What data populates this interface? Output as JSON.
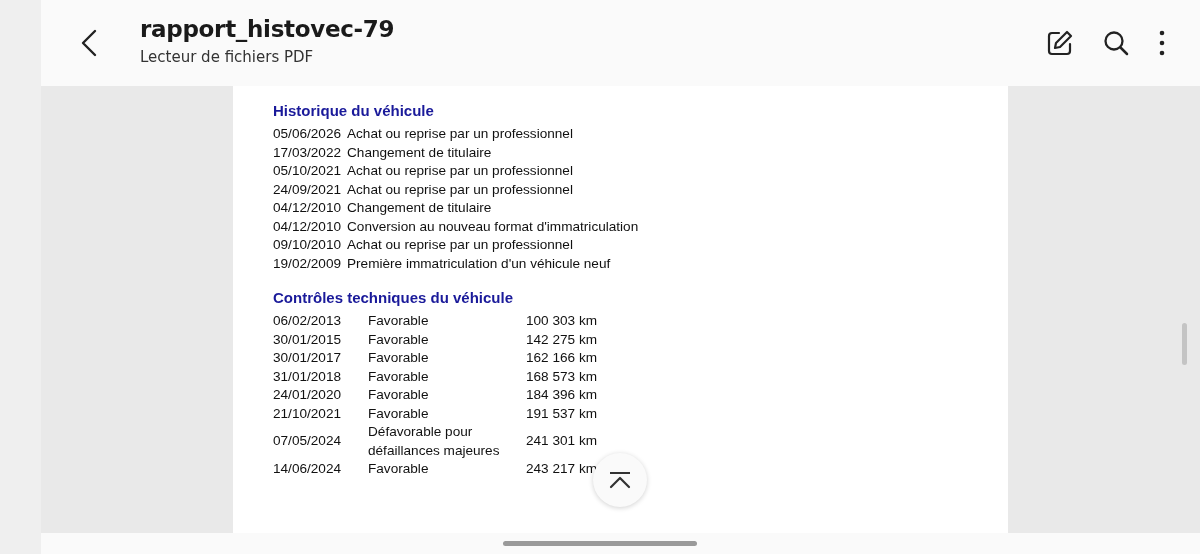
{
  "header": {
    "title": "rapport_histovec-79",
    "subtitle": "Lecteur de fichiers PDF"
  },
  "history": {
    "heading": "Historique du véhicule",
    "rows": [
      {
        "date": "05/06/2026",
        "event": "Achat ou reprise par un professionnel"
      },
      {
        "date": "17/03/2022",
        "event": "Changement de titulaire"
      },
      {
        "date": "05/10/2021",
        "event": "Achat ou reprise par un professionnel"
      },
      {
        "date": "24/09/2021",
        "event": "Achat ou reprise par un professionnel"
      },
      {
        "date": "04/12/2010",
        "event": "Changement de titulaire"
      },
      {
        "date": "04/12/2010",
        "event": "Conversion au nouveau format d'immatriculation"
      },
      {
        "date": "09/10/2010",
        "event": "Achat ou reprise par un professionnel"
      },
      {
        "date": "19/02/2009",
        "event": "Première immatriculation d'un véhicule neuf"
      }
    ]
  },
  "inspections": {
    "heading": "Contrôles techniques du véhicule",
    "rows": [
      {
        "date": "06/02/2013",
        "result": "Favorable",
        "mileage": "100 303 km"
      },
      {
        "date": "30/01/2015",
        "result": "Favorable",
        "mileage": "142 275 km"
      },
      {
        "date": "30/01/2017",
        "result": "Favorable",
        "mileage": "162 166 km"
      },
      {
        "date": "31/01/2018",
        "result": "Favorable",
        "mileage": "168 573 km"
      },
      {
        "date": "24/01/2020",
        "result": "Favorable",
        "mileage": "184 396 km"
      },
      {
        "date": "21/10/2021",
        "result": "Favorable",
        "mileage": "191 537 km"
      },
      {
        "date": "07/05/2024",
        "result": "Défavorable pour défaillances majeures",
        "mileage": "241 301 km"
      },
      {
        "date": "14/06/2024",
        "result": "Favorable",
        "mileage": "243 217 km"
      }
    ]
  }
}
